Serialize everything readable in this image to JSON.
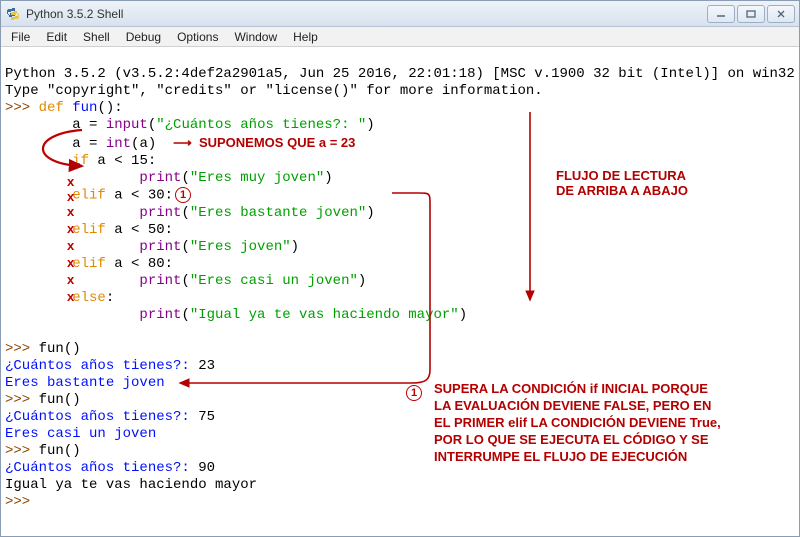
{
  "window": {
    "title": "Python 3.5.2 Shell"
  },
  "menu": [
    "File",
    "Edit",
    "Shell",
    "Debug",
    "Options",
    "Window",
    "Help"
  ],
  "banner": {
    "line1": "Python 3.5.2 (v3.5.2:4def2a2901a5, Jun 25 2016, 22:01:18) [MSC v.1900 32 bit (Intel)] on win32",
    "line2": "Type \"copyright\", \"credits\" or \"license()\" for more information."
  },
  "code": {
    "prompt": ">>> ",
    "cont": "",
    "def_kw": "def",
    "fname": "fun",
    "l1": "a = ",
    "input_call": "input",
    "str_prompt": "\"¿Cuántos años tienes?: \"",
    "l2a": "a = ",
    "int_call": "int",
    "l2b": "(a)",
    "supone_arrow": "→",
    "supone": "SUPONEMOS QUE a = 23",
    "if_kw": "if",
    "cond1": " a < 15:",
    "print_call": "print",
    "str1": "\"Eres muy joven\"",
    "elif_kw": "elif",
    "cond2": " a < 30:",
    "str2": "\"Eres bastante joven\"",
    "cond3": " a < 50:",
    "str3": "\"Eres joven\"",
    "cond4": " a < 80:",
    "str4": "\"Eres casi un joven\"",
    "else_kw": "else",
    "str5": "\"Igual ya te vas haciendo mayor\""
  },
  "runs": {
    "call": "fun()",
    "q": "¿Cuántos años tienes?: ",
    "in1": "23",
    "out1": "Eres bastante joven",
    "in2": "75",
    "out2": "Eres casi un joven",
    "in3": "90",
    "out3": "Igual ya te vas haciendo mayor"
  },
  "annotations": {
    "flow1": "FLUJO DE LECTURA",
    "flow2": "DE ARRIBA A ABAJO",
    "circle1": "1",
    "explain1": "SUPERA LA CONDICIÓN if INICIAL PORQUE",
    "explain2": "LA EVALUACIÓN DEVIENE FALSE, PERO EN",
    "explain3": "EL PRIMER elif LA CONDICIÓN DEVIENE True,",
    "explain4": "POR LO QUE SE EJECUTA EL CÓDIGO Y SE",
    "explain5": "INTERRUMPE EL FLUJO DE EJECUCIÓN",
    "x": "x"
  }
}
